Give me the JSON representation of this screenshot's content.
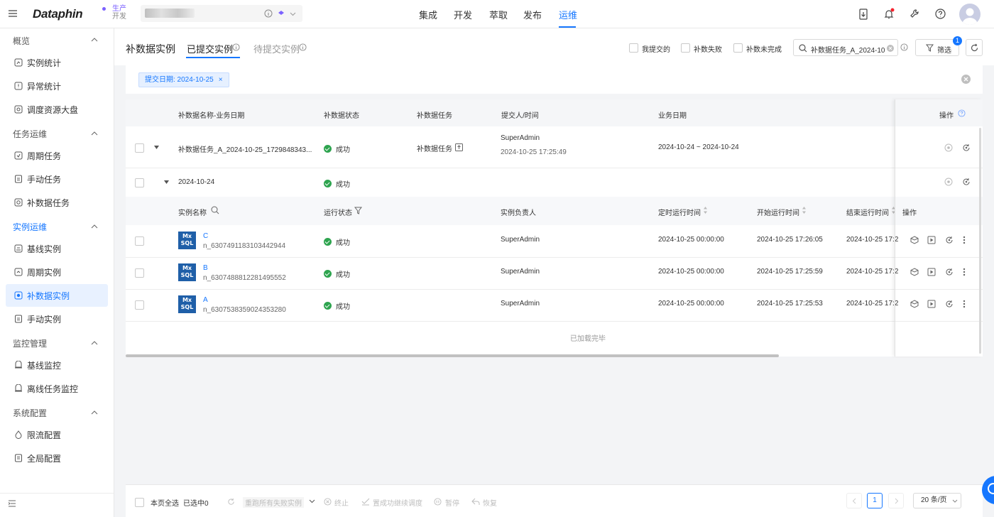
{
  "app": {
    "logo": "Dataphin",
    "env_top": "生产",
    "env_bottom": "开发"
  },
  "nav": [
    "集成",
    "开发",
    "萃取",
    "发布",
    "运维"
  ],
  "sidebar": {
    "groups": [
      {
        "label": "概览",
        "items": [
          "实例统计",
          "异常统计",
          "调度资源大盘"
        ]
      },
      {
        "label": "任务运维",
        "items": [
          "周期任务",
          "手动任务",
          "补数据任务"
        ]
      },
      {
        "label": "实例运维",
        "items": [
          "基线实例",
          "周期实例",
          "补数据实例",
          "手动实例"
        ]
      },
      {
        "label": "监控管理",
        "items": [
          "基线监控",
          "离线任务监控"
        ]
      },
      {
        "label": "系统配置",
        "items": [
          "限流配置",
          "全局配置"
        ]
      }
    ]
  },
  "header": {
    "title": "补数据实例",
    "tabs": [
      "已提交实例",
      "待提交实例"
    ],
    "checks": [
      "我提交的",
      "补数失败",
      "补数未完成"
    ],
    "search_value": "补数据任务_A_2024-10",
    "filter_label": "筛选",
    "filter_count": "1"
  },
  "filter_tag": "提交日期: 2024-10-25",
  "table": {
    "headers": [
      "补数据名称-业务日期",
      "补数据状态",
      "补数据任务",
      "提交人/时间",
      "业务日期",
      "操作"
    ],
    "row1": {
      "name": "补数据任务_A_2024-10-25_1729848343...",
      "status": "成功",
      "task": "补数据任务",
      "submitter": "SuperAdmin",
      "time": "2024-10-25 17:25:49",
      "biz_range": "2024-10-24 ~ 2024-10-24"
    },
    "row2": {
      "date": "2024-10-24",
      "status": "成功"
    },
    "sub_headers": [
      "实例名称",
      "运行状态",
      "实例负责人",
      "定时运行时间",
      "开始运行时间",
      "结束运行时间",
      "操作"
    ],
    "instances": [
      {
        "name": "C",
        "id": "n_6307491183103442944",
        "status": "成功",
        "owner": "SuperAdmin",
        "sched": "2024-10-25 00:00:00",
        "start": "2024-10-25 17:26:05",
        "end": "2024-10-25 17:2"
      },
      {
        "name": "B",
        "id": "n_6307488812281495552",
        "status": "成功",
        "owner": "SuperAdmin",
        "sched": "2024-10-25 00:00:00",
        "start": "2024-10-25 17:25:59",
        "end": "2024-10-25 17:2"
      },
      {
        "name": "A",
        "id": "n_6307538359024353280",
        "status": "成功",
        "owner": "SuperAdmin",
        "sched": "2024-10-25 00:00:00",
        "start": "2024-10-25 17:25:53",
        "end": "2024-10-25 17:2"
      }
    ],
    "loaded": "已加载完毕",
    "mxsql_top": "Mx",
    "mxsql_bottom": "SQL"
  },
  "footer": {
    "select_all": "本页全选",
    "selected": "已选中0",
    "rerun": "重跑所有失败实例",
    "stop": "终止",
    "set_success": "置成功继续调度",
    "pause": "暂停",
    "resume": "恢复",
    "page": "1",
    "page_size": "20 条/页"
  }
}
